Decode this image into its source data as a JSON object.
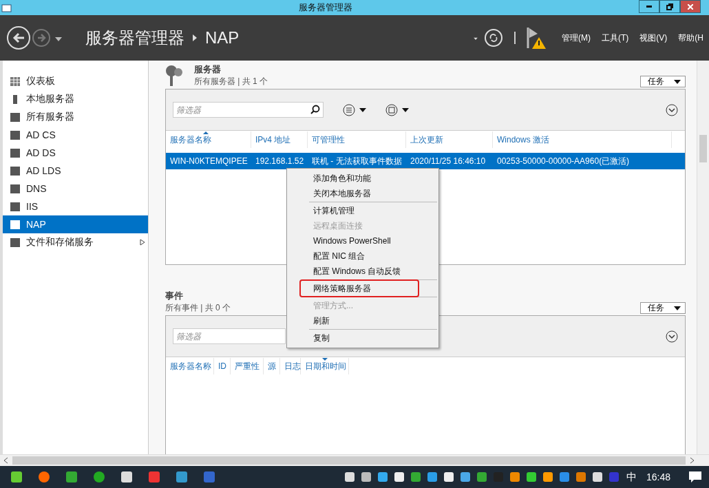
{
  "window": {
    "title": "服务器管理器"
  },
  "header": {
    "breadcrumb": [
      "服务器管理器",
      "NAP"
    ],
    "menus": [
      "管理(M)",
      "工具(T)",
      "视图(V)",
      "帮助(H"
    ]
  },
  "sidebar": {
    "items": [
      {
        "label": "仪表板",
        "selected": false,
        "has_submenu": false
      },
      {
        "label": "本地服务器",
        "selected": false,
        "has_submenu": false
      },
      {
        "label": "所有服务器",
        "selected": false,
        "has_submenu": false
      },
      {
        "label": "AD CS",
        "selected": false,
        "has_submenu": false
      },
      {
        "label": "AD DS",
        "selected": false,
        "has_submenu": false
      },
      {
        "label": "AD LDS",
        "selected": false,
        "has_submenu": false
      },
      {
        "label": "DNS",
        "selected": false,
        "has_submenu": false
      },
      {
        "label": "IIS",
        "selected": false,
        "has_submenu": false
      },
      {
        "label": "NAP",
        "selected": true,
        "has_submenu": false
      },
      {
        "label": "文件和存储服务",
        "selected": false,
        "has_submenu": true
      }
    ]
  },
  "servers": {
    "title": "服务器",
    "subtitle": "所有服务器 | 共 1 个",
    "tasks": "任务",
    "filter_placeholder": "筛选器",
    "columns": [
      {
        "label": "服务器名称",
        "sorted": true
      },
      {
        "label": "IPv4 地址",
        "sorted": false
      },
      {
        "label": "可管理性",
        "sorted": false
      },
      {
        "label": "上次更新",
        "sorted": false
      },
      {
        "label": "Windows 激活",
        "sorted": false
      }
    ],
    "rows": [
      {
        "selected": true,
        "cells": [
          "WIN-N0KTEMQIPEE",
          "192.168.1.52",
          "联机 - 无法获取事件数据",
          "2020/11/25 16:46:10",
          "00253-50000-00000-AA960(已激活)"
        ]
      }
    ]
  },
  "context_menu": {
    "groups": [
      [
        {
          "label": "添加角色和功能",
          "disabled": false,
          "highlighted": false
        },
        {
          "label": "关闭本地服务器",
          "disabled": false,
          "highlighted": false
        }
      ],
      [
        {
          "label": "计算机管理",
          "disabled": false,
          "highlighted": false
        },
        {
          "label": "远程桌面连接",
          "disabled": true,
          "highlighted": false
        },
        {
          "label": "Windows PowerShell",
          "disabled": false,
          "highlighted": false
        },
        {
          "label": "配置 NIC 组合",
          "disabled": false,
          "highlighted": false
        },
        {
          "label": "配置 Windows 自动反馈",
          "disabled": false,
          "highlighted": false
        }
      ],
      [
        {
          "label": "网络策略服务器",
          "disabled": false,
          "highlighted": true
        }
      ],
      [
        {
          "label": "管理方式...",
          "disabled": true,
          "highlighted": false
        },
        {
          "label": "刷新",
          "disabled": false,
          "highlighted": false
        }
      ],
      [
        {
          "label": "复制",
          "disabled": false,
          "highlighted": false
        }
      ]
    ]
  },
  "events": {
    "title": "事件",
    "subtitle": "所有事件 | 共 0 个",
    "tasks": "任务",
    "filter_placeholder": "筛选器",
    "columns": [
      {
        "label": "服务器名称",
        "sorted": false
      },
      {
        "label": "ID",
        "sorted": false
      },
      {
        "label": "严重性",
        "sorted": false
      },
      {
        "label": "源",
        "sorted": false
      },
      {
        "label": "日志",
        "sorted": false
      },
      {
        "label": "日期和时间",
        "sorted": true
      }
    ]
  },
  "taskbar": {
    "ime": "中",
    "clock": "16:48"
  }
}
